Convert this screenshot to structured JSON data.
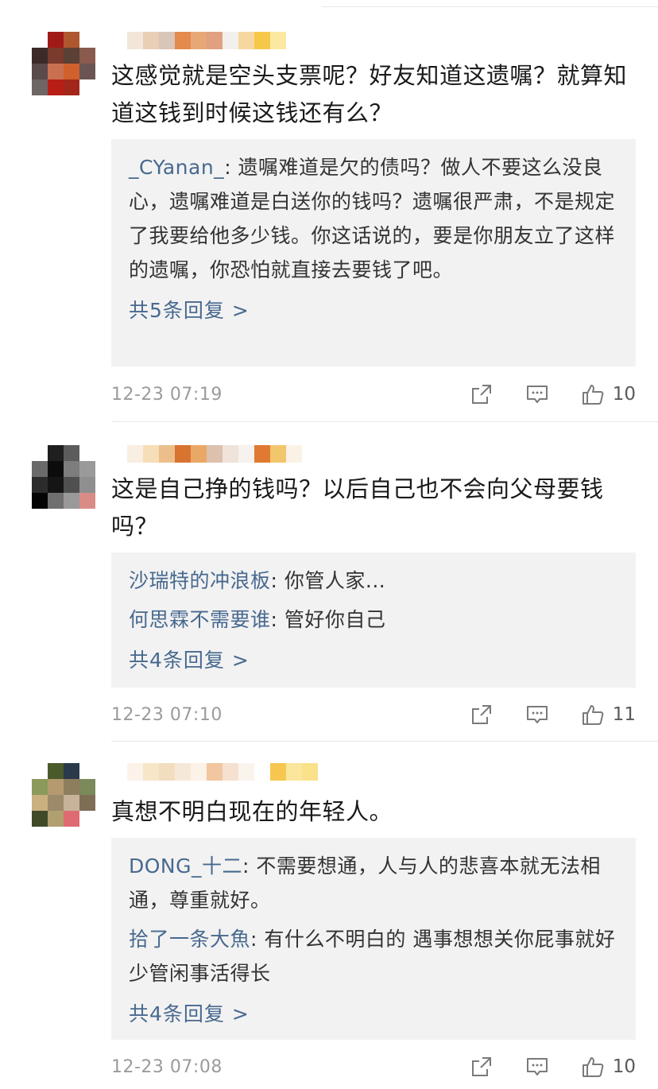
{
  "comments": [
    {
      "text": "这感觉就是空头支票呢？好友知道这遗嘱？就算知道这钱到时候这钱还有么？",
      "replies": [
        {
          "name": "_CYanan_",
          "text": ": 遗嘱难道是欠的债吗？做人不要这么没良心，遗嘱难道是白送你的钱吗？遗嘱很严肃，不是规定了我要给他多少钱。你这话说的，要是你朋友立了这样的遗嘱，你恐怕就直接去要钱了吧。"
        }
      ],
      "reply_count": "共5条回复 >",
      "time": "12-23 07:19",
      "likes": "10"
    },
    {
      "text": "这是自己挣的钱吗？以后自己也不会向父母要钱吗？",
      "replies": [
        {
          "name": "沙瑞特的冲浪板",
          "text": ": 你管人家..."
        },
        {
          "name": "何思霖不需要谁",
          "text": ": 管好你自己"
        }
      ],
      "reply_count": "共4条回复 >",
      "time": "12-23 07:10",
      "likes": "11"
    },
    {
      "text": "真想不明白现在的年轻人。",
      "replies": [
        {
          "name": "DONG_十二",
          "text": ": 不需要想通，人与人的悲喜本就无法相通，尊重就好。"
        },
        {
          "name": "拾了一条大魚",
          "text": ": 有什么不明白的  遇事想想关你屁事就好  少管闲事活得长"
        }
      ],
      "reply_count": "共4条回复 >",
      "time": "12-23 07:08",
      "likes": "10"
    }
  ],
  "icons": {
    "share": "share-icon",
    "comment": "comment-icon",
    "like": "thumbs-up-icon"
  },
  "colors": {
    "link": "#47698f",
    "reply_bg": "#f2f2f2",
    "meta": "#9b9b9b"
  }
}
